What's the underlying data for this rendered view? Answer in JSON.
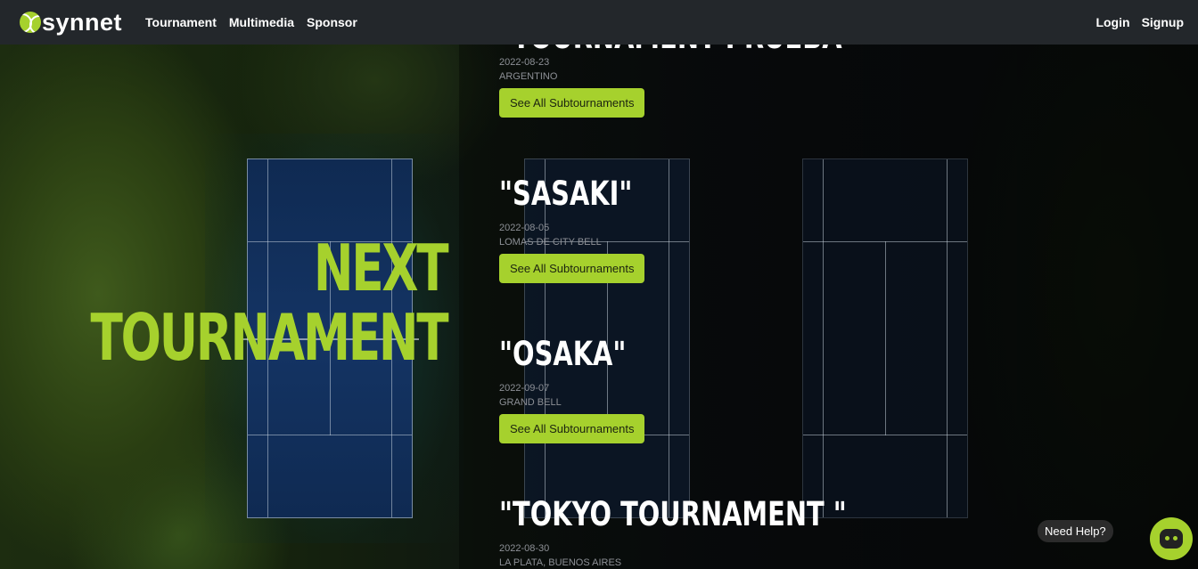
{
  "navbar": {
    "brand": "synnet",
    "links": [
      "Tournament",
      "Multimedia",
      "Sponsor"
    ],
    "login": "Login",
    "signup": "Signup"
  },
  "hero": {
    "line1": "NEXT",
    "line2": "TOURNAMENT"
  },
  "tournaments": [
    {
      "name": "\"TOURNAMENT PRUEBA\"",
      "date": "2022-08-23",
      "location": "ARGENTINO",
      "button": "See All Subtournaments"
    },
    {
      "name": "\"SASAKI\"",
      "date": "2022-08-05",
      "location": "LOMAS DE CITY BELL",
      "button": "See All Subtournaments"
    },
    {
      "name": "\"OSAKA\"",
      "date": "2022-09-07",
      "location": "GRAND BELL",
      "button": "See All Subtournaments"
    },
    {
      "name": "\"TOKYO TOURNAMENT \"",
      "date": "2022-08-30",
      "location": "LA PLATA, BUENOS AIRES"
    }
  ],
  "help": {
    "label": "Need Help?"
  },
  "colors": {
    "accent": "#a6d12d",
    "navbar": "#23272b"
  }
}
